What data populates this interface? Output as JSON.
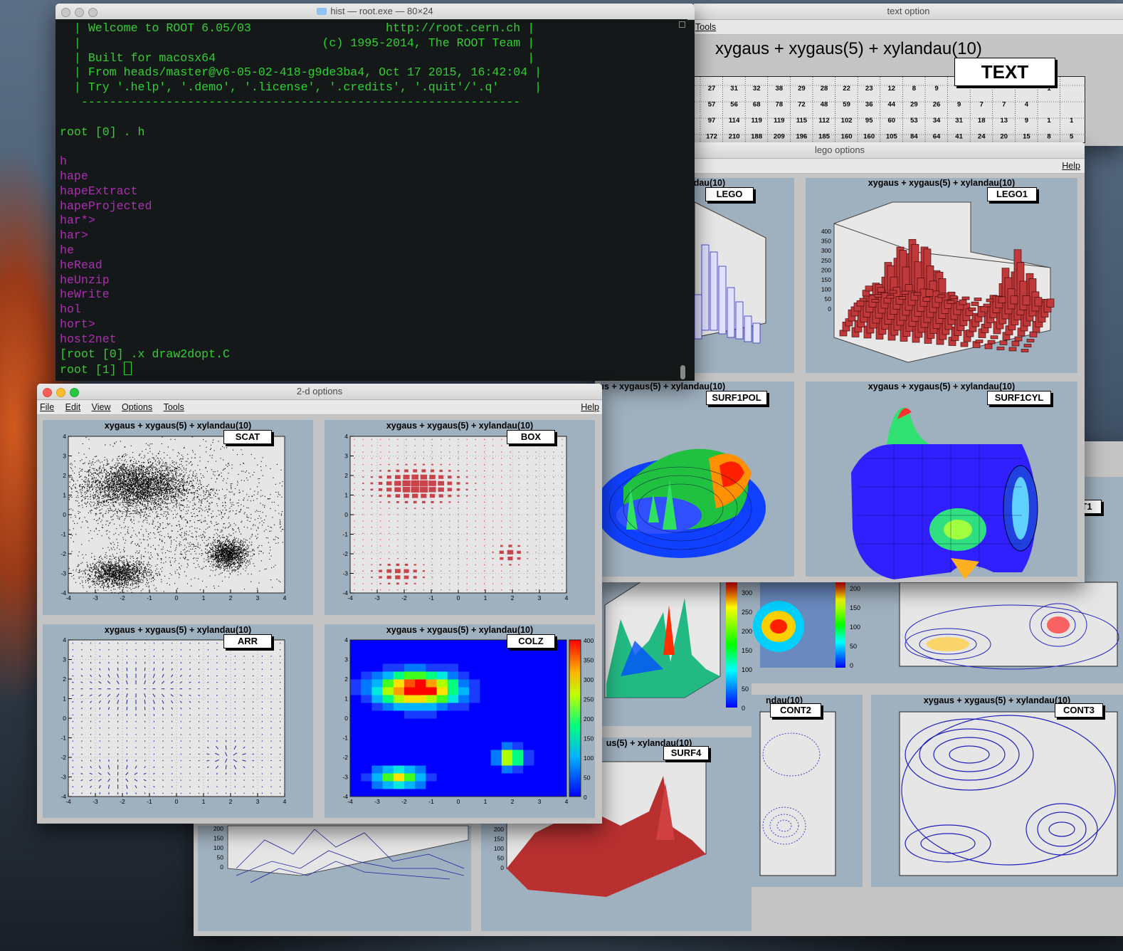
{
  "terminal": {
    "title": "hist — root.exe — 80×24",
    "lines": [
      "  | Welcome to ROOT 6.05/03                   http://root.cern.ch |",
      "  |                                  (c) 1995-2014, The ROOT Team |",
      "  | Built for macosx64                                            |",
      "  | From heads/master@v6-05-02-418-g9de3ba4, Oct 17 2015, 16:42:04 |",
      "  | Try '.help', '.demo', '.license', '.credits', '.quit'/'.q'     |",
      "   --------------------------------------------------------------",
      "",
      "root [0] . h"
    ],
    "completions": [
      "h",
      "hape",
      "hapeExtract",
      "hapeProjected",
      "har*>",
      "har>",
      "he",
      "heRead",
      "heUnzip",
      "heWrite",
      "hol",
      "hort>",
      "host2net"
    ],
    "cmd_line": "[root [0] .x draw2dopt.C",
    "prompt_line": "root [1] "
  },
  "text_window": {
    "title": "text option",
    "menu_tools": "Tools",
    "plot_title": "xygaus + xygaus(5) + xylandau(10)",
    "option_label": "TEXT",
    "rows": [
      [
        "27",
        "31",
        "32",
        "38",
        "29",
        "28",
        "22",
        "23",
        "12",
        "8",
        "9",
        "",
        "",
        "",
        "",
        "1"
      ],
      [
        "57",
        "56",
        "68",
        "78",
        "72",
        "48",
        "59",
        "36",
        "44",
        "29",
        "26",
        "9",
        "7",
        "7",
        "4",
        ""
      ],
      [
        "97",
        "114",
        "119",
        "119",
        "115",
        "112",
        "102",
        "95",
        "60",
        "53",
        "34",
        "31",
        "18",
        "13",
        "9",
        "1",
        "1"
      ],
      [
        "172",
        "210",
        "188",
        "209",
        "196",
        "185",
        "160",
        "160",
        "105",
        "84",
        "64",
        "41",
        "24",
        "20",
        "15",
        "8",
        "5"
      ]
    ]
  },
  "lego_window": {
    "title": "lego options",
    "help": "Help",
    "pads": [
      {
        "title": "xygaus + xygaus(5) + xylandau(10)",
        "option": "LEGO"
      },
      {
        "title": "xygaus + xygaus(5) + xylandau(10)",
        "option": "LEGO1"
      },
      {
        "title": "xygaus + xygaus(5) + xylandau(10)",
        "option": "SURF1POL"
      },
      {
        "title": "xygaus + xygaus(5) + xylandau(10)",
        "option": "SURF1CYL"
      }
    ],
    "lego1_z_ticks": [
      "400",
      "350",
      "300",
      "250",
      "200",
      "150",
      "100",
      "50",
      "0"
    ]
  },
  "back_window": {
    "pads": [
      {
        "title": "",
        "option": "T1"
      },
      {
        "title": "ndau(10)",
        "option": "CONT2"
      },
      {
        "title": "xygaus + xygaus(5) + xylandau(10)",
        "option": "CONT3"
      },
      {
        "title": "us(5) + xylandau(10)",
        "option": "SURF4"
      }
    ],
    "palette_a": [
      "300",
      "250",
      "200",
      "150",
      "100",
      "50",
      "0"
    ],
    "palette_b": [
      "200",
      "150",
      "100",
      "50",
      "0"
    ],
    "surf_z": [
      "200",
      "150",
      "100",
      "50",
      "0"
    ]
  },
  "main_window": {
    "title": "2-d options",
    "menu": [
      "File",
      "Edit",
      "View",
      "Options",
      "Tools"
    ],
    "help": "Help",
    "pads": [
      {
        "title": "xygaus + xygaus(5) + xylandau(10)",
        "option": "SCAT"
      },
      {
        "title": "xygaus + xygaus(5) + xylandau(10)",
        "option": "BOX"
      },
      {
        "title": "xygaus + xygaus(5) + xylandau(10)",
        "option": "ARR"
      },
      {
        "title": "xygaus + xygaus(5) + xylandau(10)",
        "option": "COLZ"
      }
    ],
    "x_ticks": [
      "-4",
      "-3",
      "-2",
      "-1",
      "0",
      "1",
      "2",
      "3",
      "4"
    ],
    "y_ticks": [
      "4",
      "3",
      "2",
      "1",
      "0",
      "-1",
      "-2",
      "-3",
      "-4"
    ],
    "colz_palette": [
      "400",
      "350",
      "300",
      "250",
      "200",
      "150",
      "100",
      "50",
      "0"
    ]
  }
}
